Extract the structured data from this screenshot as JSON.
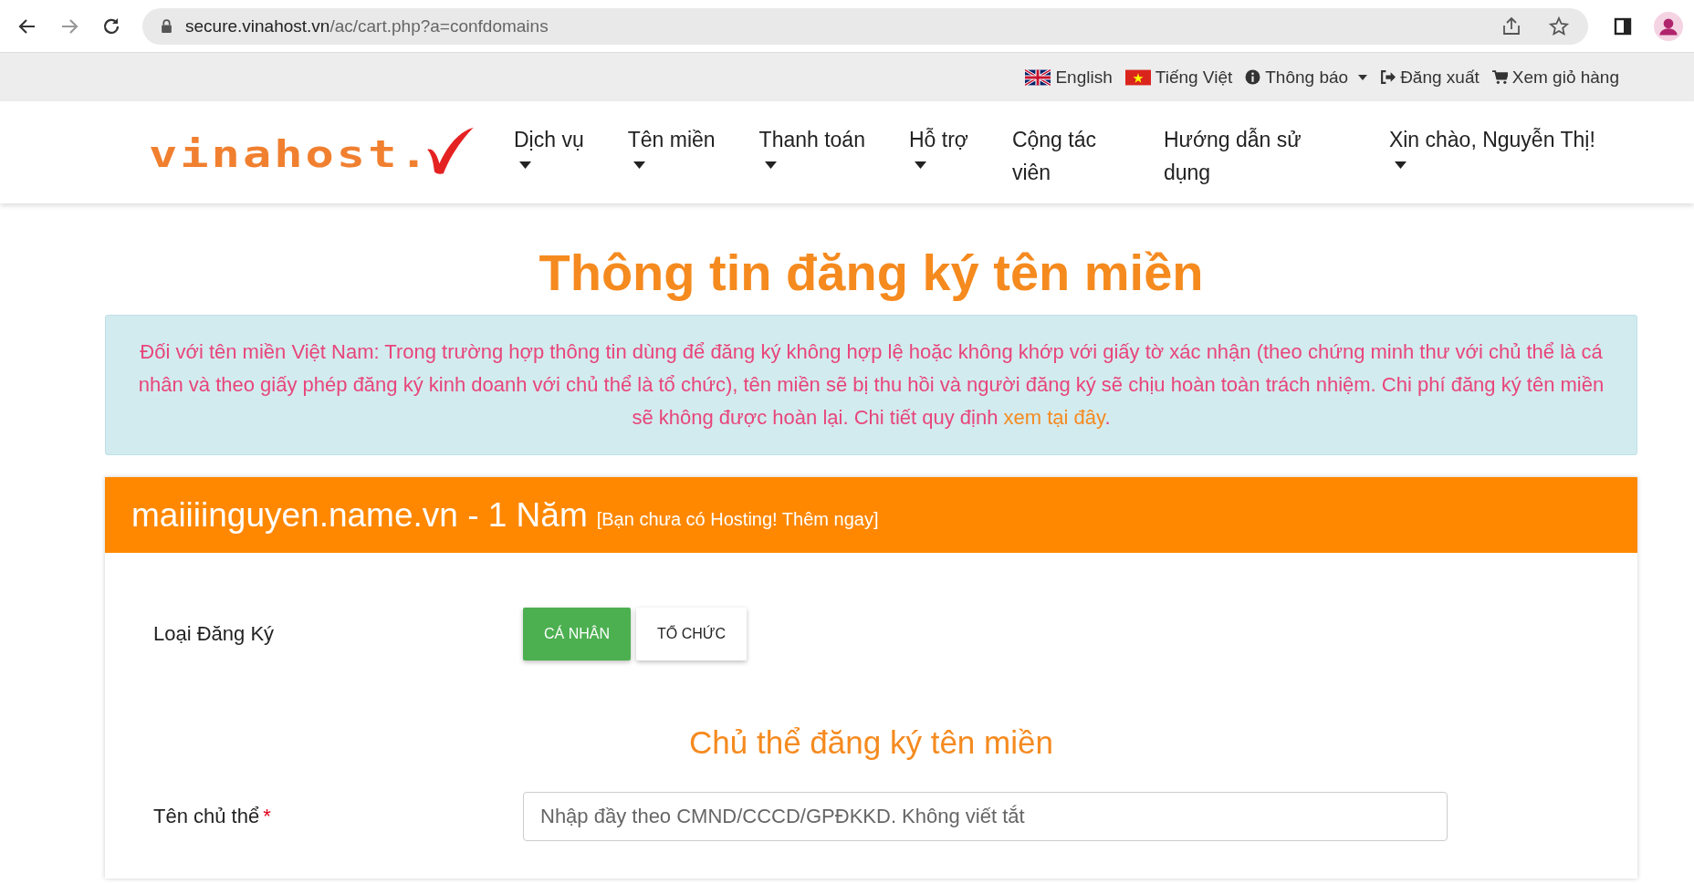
{
  "browser": {
    "url_host": "secure.vinahost.vn",
    "url_path": "/ac/cart.php?a=confdomains"
  },
  "top_bar": [
    {
      "kind": "flag-uk",
      "label": "English"
    },
    {
      "kind": "flag-vn",
      "label": "Tiếng Việt"
    },
    {
      "kind": "info",
      "label": "Thông báo",
      "dropdown": true
    },
    {
      "kind": "logout",
      "label": "Đăng xuất"
    },
    {
      "kind": "cart",
      "label": "Xem giỏ hàng"
    }
  ],
  "logo": "vinahost.",
  "nav": [
    {
      "label": "Dịch vụ",
      "dropdown": true
    },
    {
      "label": "Tên miền",
      "dropdown": true
    },
    {
      "label": "Thanh toán",
      "dropdown": true
    },
    {
      "label": "Hỗ trợ",
      "dropdown": true
    },
    {
      "label": "Cộng tác viên",
      "dropdown": false
    },
    {
      "label": "Hướng dẫn sử dụng",
      "dropdown": false
    },
    {
      "label": "Xin chào, Nguyễn Thị!",
      "dropdown": true
    }
  ],
  "title": "Thông tin đăng ký tên miền",
  "alert": {
    "text": "Đối với tên miền Việt Nam: Trong trường hợp thông tin dùng để đăng ký không hợp lệ hoặc không khớp với giấy tờ xác nhận (theo chứng minh thư với chủ thể là cá nhân và theo giấy phép đăng ký kinh doanh với chủ thể là tổ chức), tên miền sẽ bị thu hồi và người đăng ký sẽ chịu hoàn toàn trách nhiệm. Chi phí đăng ký tên miền sẽ không được hoàn lại. Chi tiết quy định ",
    "link": "xem tại đây",
    "after": "."
  },
  "card": {
    "domain": "maiiiinguyen.name.vn - 1 Năm",
    "hosting_link": "[Bạn chưa có Hosting! Thêm ngay]",
    "type_label": "Loại Đăng Ký",
    "types": [
      {
        "label": "CÁ NHÂN",
        "selected": true
      },
      {
        "label": "TỔ CHỨC",
        "selected": false
      }
    ],
    "section_title": "Chủ thể đăng ký tên miền",
    "fields": [
      {
        "label": "Tên chủ thể",
        "required_mark": "*",
        "placeholder": "Nhập đầy theo CMND/CCCD/GPĐKKD. Không viết tắt"
      }
    ]
  }
}
